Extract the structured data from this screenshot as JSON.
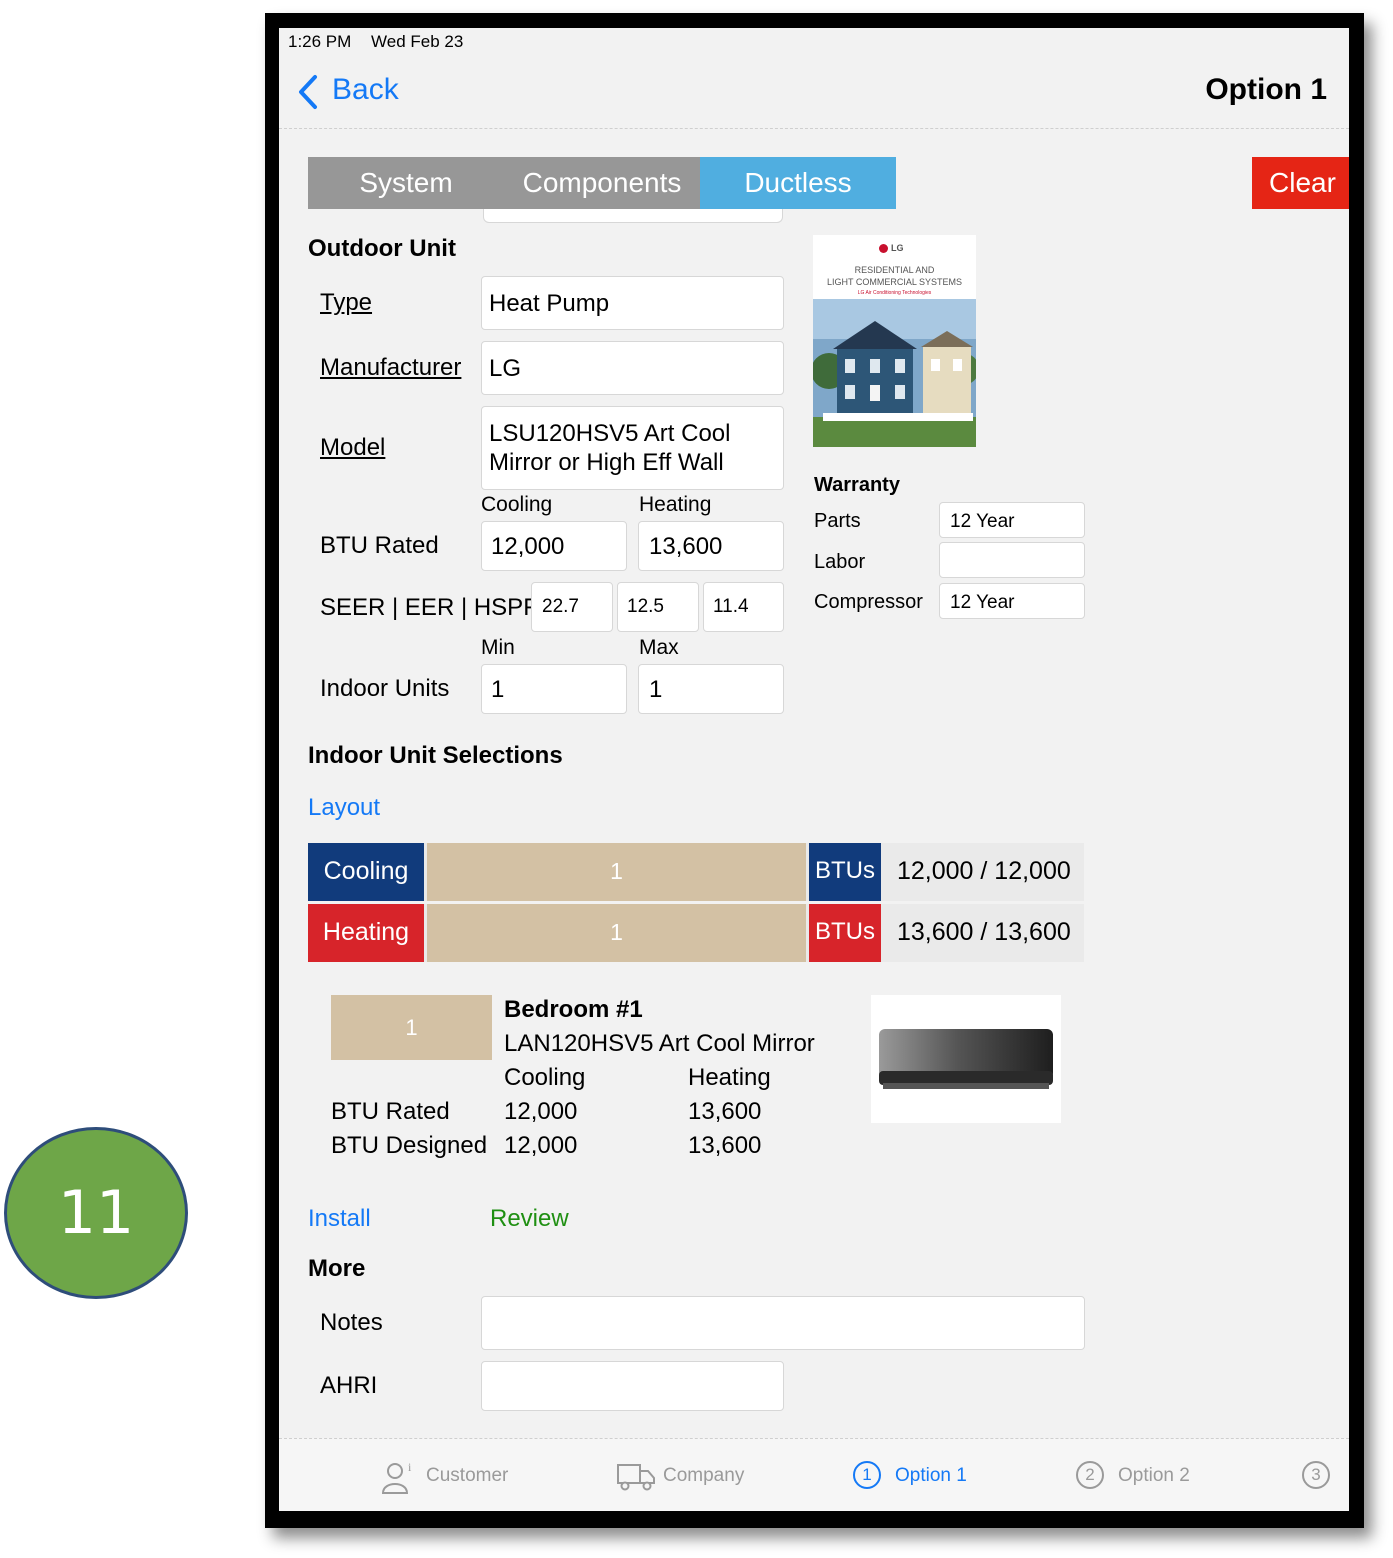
{
  "step_badge": "11",
  "status_bar": {
    "time": "1:26 PM",
    "date": "Wed Feb 23"
  },
  "nav": {
    "back_label": "Back",
    "title": "Option 1"
  },
  "tabs": [
    {
      "label": "System",
      "active": false
    },
    {
      "label": "Components",
      "active": false
    },
    {
      "label": "Ductless",
      "active": true
    }
  ],
  "clear_label": "Clear",
  "outdoor": {
    "heading": "Outdoor Unit",
    "type_label": "Type",
    "type_value": "Heat Pump",
    "manufacturer_label": "Manufacturer",
    "manufacturer_value": "LG",
    "model_label": "Model",
    "model_line1": "LSU120HSV5 Art Cool",
    "model_line2": "Mirror or High Eff Wall",
    "cooling_label": "Cooling",
    "heating_label": "Heating",
    "btu_label": "BTU Rated",
    "btu_cooling": "12,000",
    "btu_heating": "13,600",
    "seer_label": "SEER | EER | HSPF",
    "seer": "22.7",
    "eer": "12.5",
    "hspf": "11.4",
    "min_label": "Min",
    "max_label": "Max",
    "indoor_units_label": "Indoor Units",
    "indoor_min": "1",
    "indoor_max": "1"
  },
  "brochure": {
    "brand": "LG",
    "title_line1": "RESIDENTIAL AND",
    "title_line2": "LIGHT COMMERCIAL SYSTEMS",
    "subtitle": "LG Air Conditioning Technologies"
  },
  "warranty": {
    "heading": "Warranty",
    "parts_label": "Parts",
    "parts_value": "12 Year",
    "labor_label": "Labor",
    "labor_value": "",
    "compressor_label": "Compressor",
    "compressor_value": "12 Year"
  },
  "indoor_selections": {
    "heading": "Indoor Unit Selections",
    "layout_link": "Layout",
    "rows": [
      {
        "label": "Cooling",
        "count": "1",
        "unit": "BTUs",
        "value": "12,000 / 12,000"
      },
      {
        "label": "Heating",
        "count": "1",
        "unit": "BTUs",
        "value": "13,600 / 13,600"
      }
    ]
  },
  "room": {
    "number": "1",
    "name": "Bedroom #1",
    "model": "LAN120HSV5 Art Cool Mirror",
    "cooling_label": "Cooling",
    "heating_label": "Heating",
    "rated_label": "BTU Rated",
    "rated_cooling": "12,000",
    "rated_heating": "13,600",
    "designed_label": "BTU Designed",
    "designed_cooling": "12,000",
    "designed_heating": "13,600"
  },
  "links": {
    "install": "Install",
    "review": "Review"
  },
  "more": {
    "heading": "More",
    "notes_label": "Notes",
    "notes_value": "",
    "ahri_label": "AHRI",
    "ahri_value": ""
  },
  "bottom_tabs": [
    {
      "label": "Customer",
      "icon": "customer-icon"
    },
    {
      "label": "Company",
      "icon": "truck-icon"
    },
    {
      "label": "Option 1",
      "number": "1",
      "active": true
    },
    {
      "label": "Option 2",
      "number": "2",
      "active": false
    },
    {
      "label": "",
      "number": "3",
      "active": false
    }
  ],
  "colors": {
    "accent": "#1479f6",
    "active_tab": "#50aee0",
    "clear": "#e52515",
    "cooling": "#113b7c",
    "heating": "#d7242a",
    "tan": "#d3c1a4",
    "review": "#1f8f12",
    "badge": "#6ea648"
  }
}
